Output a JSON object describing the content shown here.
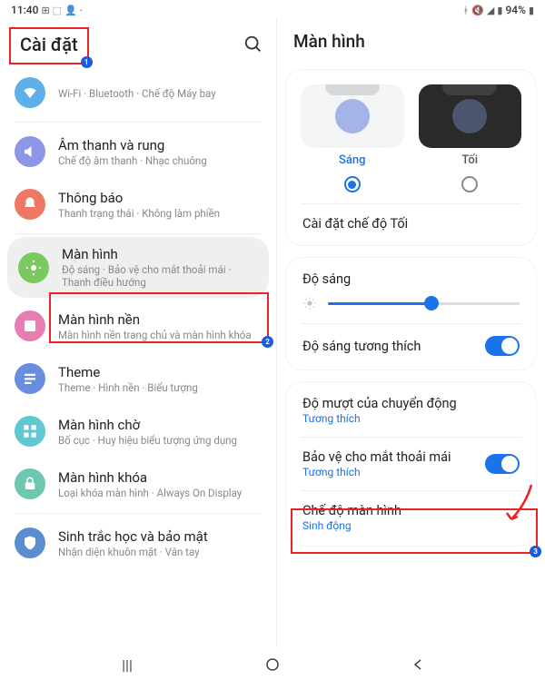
{
  "statusbar": {
    "time": "11:40",
    "battery": "94%"
  },
  "left": {
    "title": "Cài đặt",
    "items": [
      {
        "title": "",
        "sub": "Wi-Fi  ·  Bluetooth  ·  Chế độ Máy bay"
      },
      {
        "title": "Âm thanh và rung",
        "sub": "Chế độ âm thanh  ·  Nhạc chuông"
      },
      {
        "title": "Thông báo",
        "sub": "Thanh trạng thái  ·  Không làm phiền"
      },
      {
        "title": "Màn hình",
        "sub": "Độ sáng  ·  Bảo vệ cho mắt thoải mái  ·  Thanh điều hướng"
      },
      {
        "title": "Màn hình nền",
        "sub": "Màn hình nền trang chủ và màn hình khóa"
      },
      {
        "title": "Theme",
        "sub": "Theme  ·  Hình nền  ·  Biểu tượng"
      },
      {
        "title": "Màn hình chờ",
        "sub": "Bố cục  ·  Huy hiệu biểu tượng ứng dụng"
      },
      {
        "title": "Màn hình khóa",
        "sub": "Loại khóa màn hình  ·  Always On Display"
      },
      {
        "title": "Sinh trắc học và bảo mật",
        "sub": "Nhận diện khuôn mặt  ·  Vân tay"
      }
    ]
  },
  "right": {
    "title": "Màn hình",
    "mode": {
      "light": "Sáng",
      "dark": "Tối",
      "selected": "light"
    },
    "dark_settings": "Cài đặt chế độ Tối",
    "brightness": {
      "label": "Độ sáng",
      "value": 54
    },
    "adaptive": {
      "label": "Độ sáng tương thích",
      "on": true
    },
    "motion": {
      "label": "Độ mượt của chuyển động",
      "sub": "Tương thích"
    },
    "eyecomfort": {
      "label": "Bảo vệ cho mắt thoải mái",
      "sub": "Tương thích",
      "on": true
    },
    "screenmode": {
      "label": "Chế độ màn hình",
      "sub": "Sinh động"
    }
  }
}
